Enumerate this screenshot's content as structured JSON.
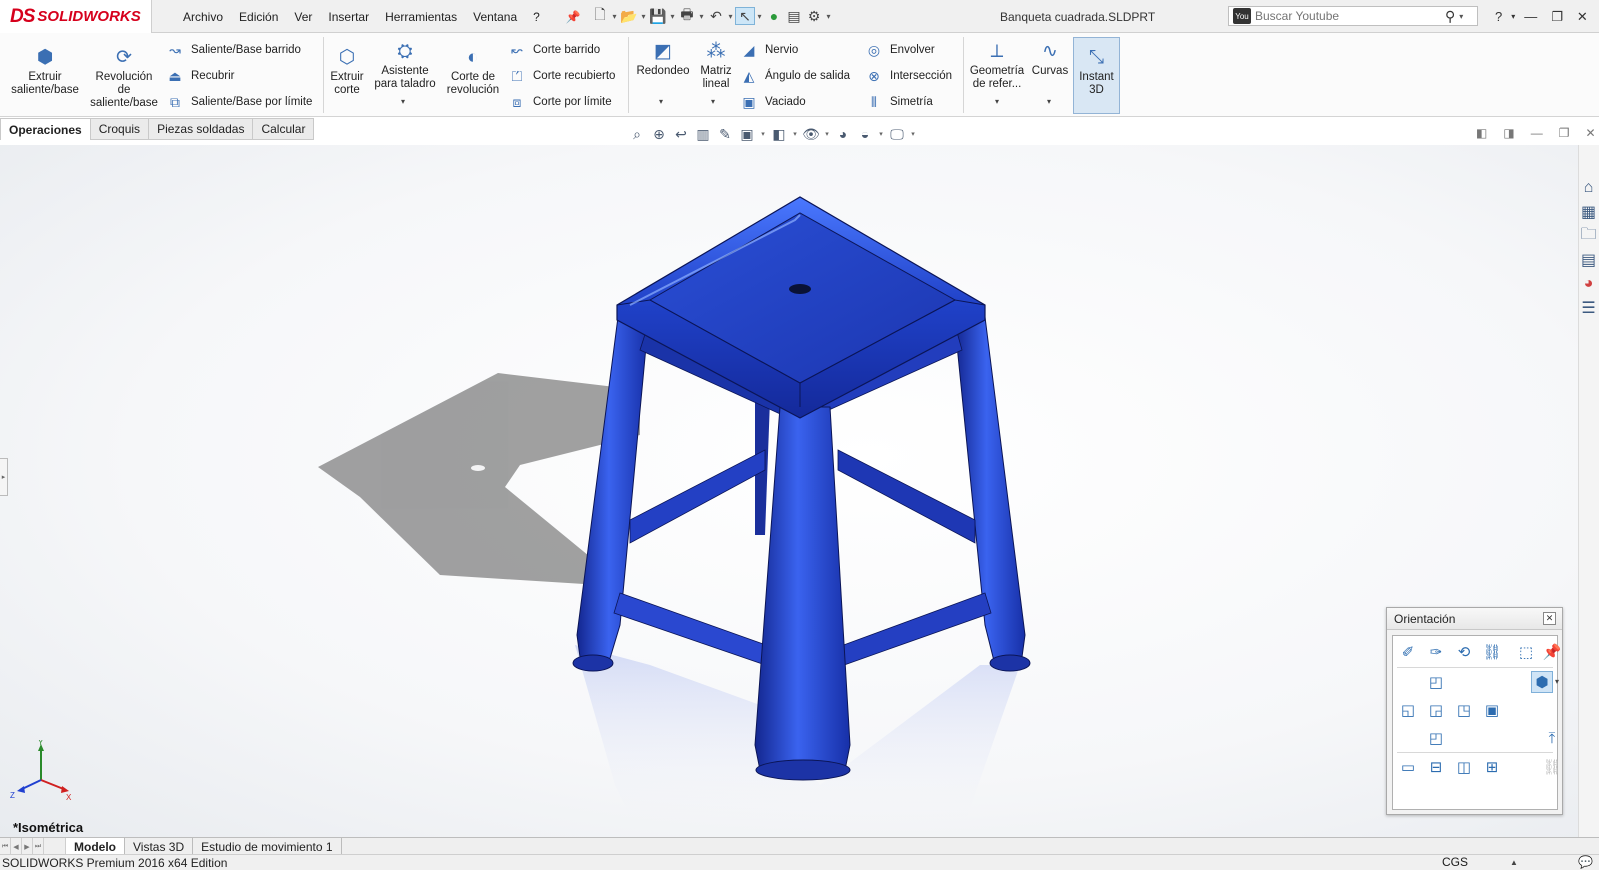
{
  "app": {
    "logo_ds": "DS",
    "logo_name": "SOLIDWORKS",
    "document_title": "Banqueta cuadrada.SLDPRT"
  },
  "menu": [
    "Archivo",
    "Edición",
    "Ver",
    "Insertar",
    "Herramientas",
    "Ventana",
    "?"
  ],
  "search": {
    "placeholder": "Buscar Youtube"
  },
  "ribbon": {
    "extrude_boss": "Extruir saliente/base",
    "revolve_boss": "Revolución de saliente/base",
    "swept_boss": "Saliente/Base barrido",
    "loft": "Recubrir",
    "boundary_boss": "Saliente/Base por límite",
    "extrude_cut": "Extruir corte",
    "hole_wizard": "Asistente para taladro",
    "revolve_cut": "Corte de revolución",
    "swept_cut": "Corte barrido",
    "lofted_cut": "Corte recubierto",
    "boundary_cut": "Corte por límite",
    "fillet": "Redondeo",
    "linear_pattern": "Matriz lineal",
    "rib": "Nervio",
    "draft": "Ángulo de salida",
    "shell": "Vaciado",
    "wrap": "Envolver",
    "intersect": "Intersección",
    "mirror": "Simetría",
    "ref_geometry": "Geometría de refer...",
    "curves": "Curvas",
    "instant3d": "Instant 3D"
  },
  "command_tabs": [
    "Operaciones",
    "Croquis",
    "Piezas soldadas",
    "Calcular"
  ],
  "viewport": {
    "view_label": "*Isométrica",
    "part_color": "#1f3fc4"
  },
  "orientation_dialog": {
    "title": "Orientación"
  },
  "bottom_tabs": [
    "Modelo",
    "Vistas 3D",
    "Estudio de movimiento 1"
  ],
  "status": {
    "edition": "SOLIDWORKS Premium 2016 x64 Edition",
    "units": "CGS"
  }
}
